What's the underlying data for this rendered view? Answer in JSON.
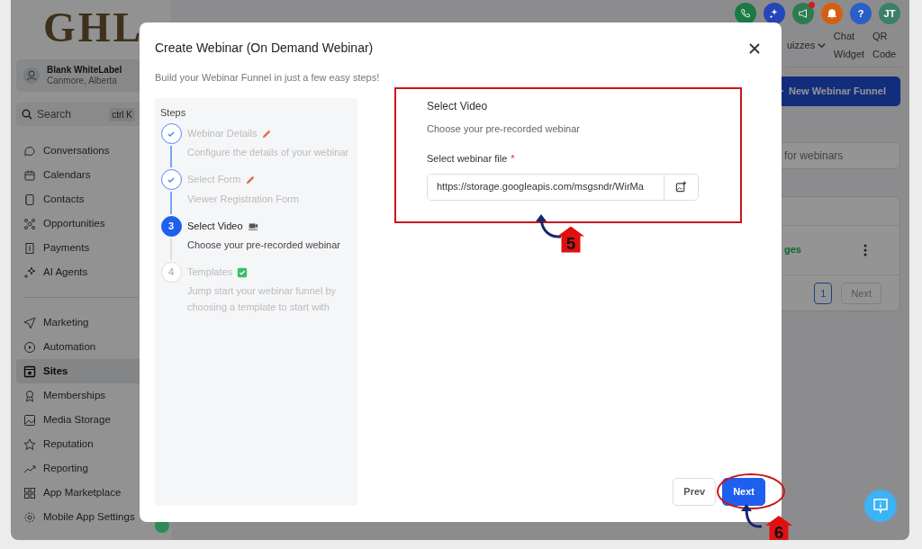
{
  "app": {
    "logo": "GHL",
    "account": {
      "name": "Blank WhiteLabel",
      "location": "Canmore, Alberta"
    },
    "search": {
      "placeholder": "Search",
      "shortcut": "ctrl K"
    },
    "nav_groups": [
      [
        {
          "label": "Conversations",
          "selected": false
        },
        {
          "label": "Calendars",
          "selected": false
        },
        {
          "label": "Contacts",
          "selected": false
        },
        {
          "label": "Opportunities",
          "selected": false
        },
        {
          "label": "Payments",
          "selected": false
        },
        {
          "label": "AI Agents",
          "selected": false
        }
      ],
      [
        {
          "label": "Marketing",
          "selected": false
        },
        {
          "label": "Automation",
          "selected": false
        },
        {
          "label": "Sites",
          "selected": true
        },
        {
          "label": "Memberships",
          "selected": false
        },
        {
          "label": "Media Storage",
          "selected": false
        },
        {
          "label": "Reputation",
          "selected": false
        },
        {
          "label": "Reporting",
          "selected": false
        },
        {
          "label": "App Marketplace",
          "selected": false
        },
        {
          "label": "Mobile App Settings",
          "selected": false
        }
      ]
    ],
    "header_icons": [
      {
        "kind": "phone",
        "color": "#1b7a43",
        "badge": false
      },
      {
        "kind": "sparkle",
        "color": "#2646b8",
        "badge": false
      },
      {
        "kind": "megaphone",
        "color": "#2d7b50",
        "badge": true
      },
      {
        "kind": "bell",
        "color": "#d4600f",
        "badge": false
      },
      {
        "kind": "help",
        "color": "#2b5fc6",
        "badge": false,
        "label": "?"
      },
      {
        "kind": "avatar",
        "color": "#3c8068",
        "badge": false,
        "label": "JT"
      }
    ],
    "header_nav": [
      {
        "label": "uizzes",
        "dropdown": true
      },
      {
        "label": "Chat Widget",
        "dropdown": false
      },
      {
        "label": "QR Code",
        "dropdown": false
      }
    ],
    "new_button": "New Webinar Funnel",
    "search_field": {
      "placeholder": "for webinars"
    },
    "table": {
      "cell": "ges"
    },
    "pagination": {
      "page": "1",
      "next": "Next"
    }
  },
  "modal": {
    "title": "Create Webinar (On Demand Webinar)",
    "subtitle": "Build your Webinar Funnel in just a few easy steps!",
    "steps_heading": "Steps",
    "steps": [
      {
        "kind": "done",
        "title": "Webinar Details",
        "description": "Configure the details of your webinar"
      },
      {
        "kind": "done",
        "title": "Select Form",
        "description": "Viewer Registration Form"
      },
      {
        "kind": "current",
        "number": "3",
        "title": "Select Video",
        "description": "Choose your pre-recorded webinar"
      },
      {
        "kind": "pending",
        "number": "4",
        "title": "Templates",
        "description": "Jump start your webinar funnel by choosing a template to start with"
      }
    ],
    "section": {
      "title": "Select Video",
      "description": "Choose your pre-recorded webinar",
      "field": {
        "label": "Select webinar file",
        "required_mark": "*",
        "value": "https://storage.googleapis.com/msgsndr/WirMa"
      }
    },
    "buttons": [
      {
        "label": "Prev",
        "kind": "secondary"
      },
      {
        "label": "Next",
        "kind": "primary"
      }
    ]
  },
  "annotations": [
    {
      "number": "5"
    },
    {
      "number": "6"
    }
  ]
}
